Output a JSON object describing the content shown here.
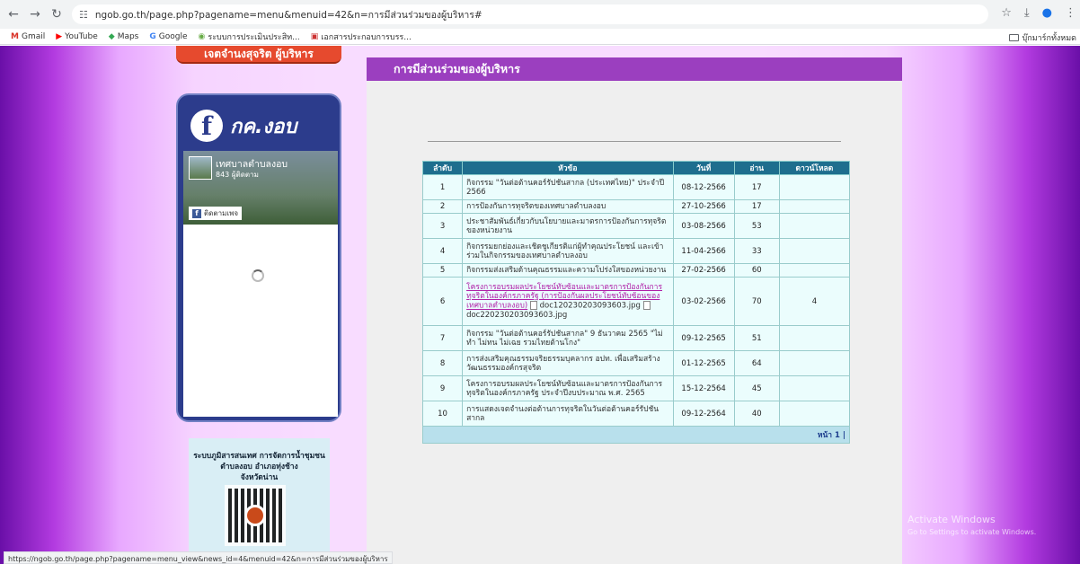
{
  "browser": {
    "url": "ngob.go.th/page.php?pagename=menu&menuid=42&n=การมีส่วนร่วมของผู้บริหาร#",
    "bookmarks": [
      "Gmail",
      "YouTube",
      "Maps",
      "Google",
      "ระบบการประเมินประสิท...",
      "เอกสารประกอบการบรร..."
    ],
    "bookmarks_folder": "บุ๊กมาร์กทั้งหมด"
  },
  "sidebar": {
    "banner": "เจตจำนงสุจริต ผู้บริหาร",
    "fb_title": "กค.งอบ",
    "fb_page_name": "เทศบาลตำบลงอบ",
    "fb_likes": "843 ผู้ติดตาม",
    "fb_follow": "ติดตามเพจ",
    "qr_text_1": "ระบบภูมิสารสนเทศ การจัดการน้ำชุมชน",
    "qr_text_2": "ตำบลงอบ อำเภอทุ่งช้าง",
    "qr_text_3": "จังหวัดน่าน"
  },
  "content": {
    "heading": "การมีส่วนร่วมของผู้บริหาร",
    "columns": [
      "ลำดับ",
      "หัวข้อ",
      "วันที่",
      "อ่าน",
      "ดาวน์โหลด"
    ],
    "rows": [
      {
        "no": "1",
        "title": "กิจกรรม \"วันต่อต้านคอร์รัปชันสากล (ประเทศไทย)\" ประจำปี 2566",
        "date": "08-12-2566",
        "read": "17",
        "dl": ""
      },
      {
        "no": "2",
        "title": "การป้องกันการทุจริตของเทศบาลตำบลงอบ",
        "date": "27-10-2566",
        "read": "17",
        "dl": ""
      },
      {
        "no": "3",
        "title": "ประชาสัมพันธ์เกี่ยวกับนโยบายและมาตรการป้องกันการทุจริตของหน่วยงาน",
        "date": "03-08-2566",
        "read": "53",
        "dl": ""
      },
      {
        "no": "4",
        "title": "กิจกรรมยกย่องและเชิดชูเกียรติแก่ผู้ทำคุณประโยชน์ และเข้าร่วมในกิจกรรมของเทศบาลตำบลงอบ",
        "date": "11-04-2566",
        "read": "33",
        "dl": ""
      },
      {
        "no": "5",
        "title": "กิจกรรมส่งเสริมด้านคุณธรรมและความโปร่งใสของหน่วยงาน",
        "date": "27-02-2566",
        "read": "60",
        "dl": ""
      },
      {
        "no": "6",
        "title": "โครงการอบรมผลประโยชน์ทับซ้อนและมาตรการป้องกันการทุจริตในองค์กรภาครัฐ (การป้องกันผลประโยชน์ทับซ้อนของเทศบาลตำบลงอบ)",
        "files": "doc120230203093603.jpg",
        "files2": "doc220230203093603.jpg",
        "date": "03-02-2566",
        "read": "70",
        "dl": "4"
      },
      {
        "no": "7",
        "title": "กิจกรรม \"วันต่อต้านคอร์รัปชันสากล\" 9 ธันวาคม 2565 \"ไม่ทำ ไม่ทน ไม่เฉย รวมไทยต้านโกง\"",
        "date": "09-12-2565",
        "read": "51",
        "dl": ""
      },
      {
        "no": "8",
        "title": "การส่งเสริมคุณธรรมจริยธรรมบุคลากร อปท. เพื่อเสริมสร้างวัฒนธรรมองค์กรสุจริต",
        "date": "01-12-2565",
        "read": "64",
        "dl": ""
      },
      {
        "no": "9",
        "title": "โครงการอบรมผลประโยชน์ทับซ้อนและมาตรการป้องกันการทุจริตในองค์กรภาครัฐ ประจำปีงบประมาณ พ.ศ. 2565",
        "date": "15-12-2564",
        "read": "45",
        "dl": ""
      },
      {
        "no": "10",
        "title": "การแสดงเจตจำนงต่อต้านการทุจริตในวันต่อต้านคอร์รัปชันสากล",
        "date": "09-12-2564",
        "read": "40",
        "dl": ""
      }
    ],
    "pagination": "หน้า 1 |"
  },
  "status_url": "https://ngob.go.th/page.php?pagename=menu_view&news_id=4&menuid=42&n=การมีส่วนร่วมของผู้บริหาร",
  "watermark": {
    "line1": "Activate Windows",
    "line2": "Go to Settings to activate Windows."
  }
}
